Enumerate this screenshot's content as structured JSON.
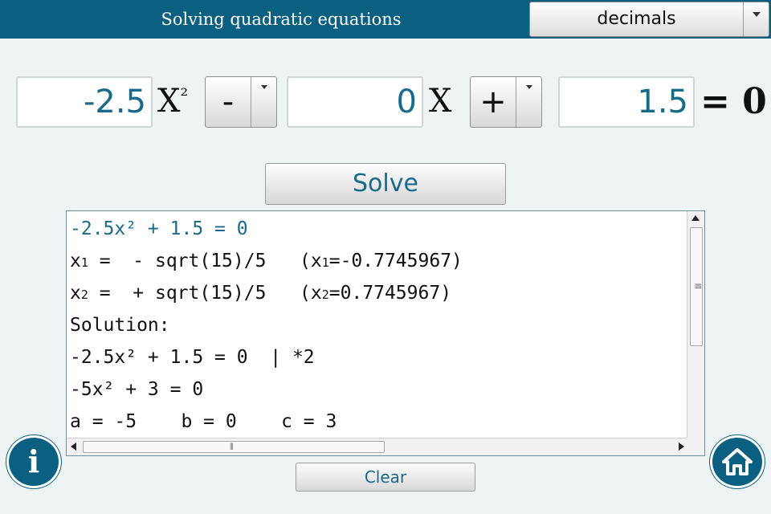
{
  "header": {
    "title": "Solving quadratic equations",
    "mode_selected": "decimals"
  },
  "equation": {
    "a": "-2.5",
    "x2_label": "X",
    "x2_sup": "²",
    "sign1": "-",
    "b": "0",
    "x_label": "X",
    "sign2": "+",
    "c": "1.5",
    "equals": "= 0"
  },
  "solve_label": "Solve",
  "output": {
    "lines": [
      {
        "text": "-2.5x² + 1.5 = 0",
        "style": "eq"
      },
      {
        "pre": "x",
        "sub": "1",
        "mid": " =  - sqrt(15)/5   (x",
        "sub2": "1",
        "post": "=-0.7745967)"
      },
      {
        "pre": "x",
        "sub": "2",
        "mid": " =  + sqrt(15)/5   (x",
        "sub2": "2",
        "post": "=0.7745967)"
      },
      {
        "text": "Solution:"
      },
      {
        "text": "-2.5x² + 1.5 = 0  | *2"
      },
      {
        "text": "-5x² + 3 = 0"
      },
      {
        "text": "a = -5    b = 0    c = 3"
      }
    ]
  },
  "clear_label": "Clear",
  "icons": {
    "info": "i",
    "home": "home-icon",
    "dropdown": "chevron-down-icon"
  },
  "colors": {
    "brand": "#0b5f80",
    "accent_text": "#1a6a8a",
    "background": "#eef4f3"
  }
}
